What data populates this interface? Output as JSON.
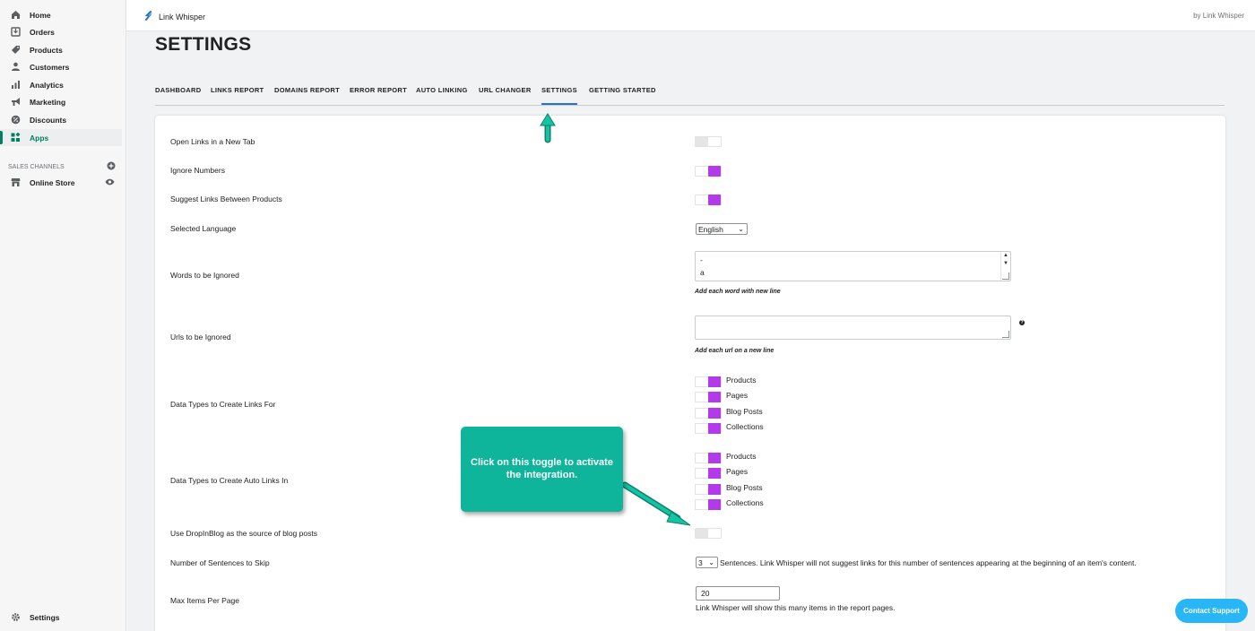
{
  "sidebar": {
    "items": [
      {
        "label": "Home",
        "icon": "home-icon"
      },
      {
        "label": "Orders",
        "icon": "orders-icon"
      },
      {
        "label": "Products",
        "icon": "tag-icon"
      },
      {
        "label": "Customers",
        "icon": "person-icon"
      },
      {
        "label": "Analytics",
        "icon": "bar-chart-icon"
      },
      {
        "label": "Marketing",
        "icon": "megaphone-icon"
      },
      {
        "label": "Discounts",
        "icon": "discount-icon"
      },
      {
        "label": "Apps",
        "icon": "apps-icon"
      }
    ],
    "sales_channels_label": "SALES CHANNELS",
    "online_store_label": "Online Store",
    "settings_label": "Settings"
  },
  "topbar": {
    "app_name": "Link Whisper",
    "by_text": "by Link Whisper"
  },
  "page": {
    "title": "SETTINGS"
  },
  "tabs": [
    "DASHBOARD",
    "LINKS REPORT",
    "DOMAINS REPORT",
    "ERROR REPORT",
    "AUTO LINKING",
    "URL CHANGER",
    "SETTINGS",
    "GETTING STARTED"
  ],
  "active_tab": "SETTINGS",
  "settings": {
    "open_links_label": "Open Links in a New Tab",
    "open_links_on": false,
    "ignore_numbers_label": "Ignore Numbers",
    "ignore_numbers_on": true,
    "suggest_links_label": "Suggest Links Between Products",
    "suggest_links_on": true,
    "language_label": "Selected Language",
    "language_value": "English",
    "words_ignored_label": "Words to be Ignored",
    "words_ignored_lines": [
      "-",
      "a"
    ],
    "words_ignored_hint": "Add each word with new line",
    "urls_ignored_label": "Urls to be Ignored",
    "urls_ignored_hint": "Add each url on a new line",
    "data_types_links_label": "Data Types to Create Links For",
    "data_types_links": [
      "Products",
      "Pages",
      "Blog Posts",
      "Collections"
    ],
    "data_types_auto_label": "Data Types to Create Auto Links In",
    "data_types_auto": [
      "Products",
      "Pages",
      "Blog Posts",
      "Collections"
    ],
    "dropinblog_label": "Use DropInBlog as the source of blog posts",
    "dropinblog_on": false,
    "sentences_label": "Number of Sentences to Skip",
    "sentences_value": "3",
    "sentences_text": "Sentences. Link Whisper will not suggest links for this number of sentences appearing at the beginning of an item's content.",
    "max_items_label": "Max Items Per Page",
    "max_items_value": "20",
    "max_items_hint": "Link Whisper will show this many items in the report pages."
  },
  "callout": {
    "text": "Click on this toggle to activate the integration."
  },
  "contact_support_label": "Contact Support",
  "colors": {
    "accent_green": "#008060",
    "toggle_purple": "#b23ae8",
    "callout_teal": "#0fb59a",
    "contact_blue": "#29b6f6",
    "tab_underline": "#2c6ecb"
  }
}
